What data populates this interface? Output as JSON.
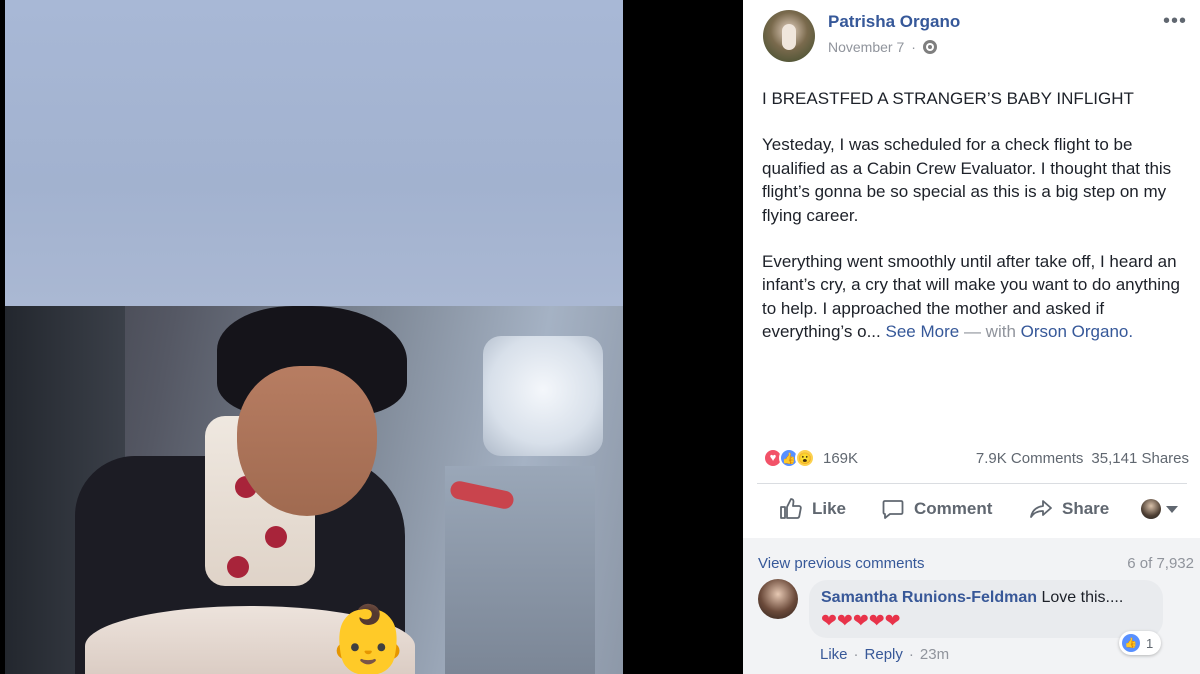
{
  "post": {
    "author": "Patrisha Organo",
    "date": "November 7",
    "date_separator": "·",
    "more": "•••",
    "headline": "I BREASTFED A STRANGER’S BABY INFLIGHT",
    "paragraph1": "Yesteday, I was scheduled for a check flight to be qualified as a Cabin Crew Evaluator. I thought that this flight’s gonna be so special as this is a big step on my flying career.",
    "paragraph2": "Everything went smoothly until after take off, I heard an infant’s cry, a cry that will make you want to do anything to help. I approached the mother and asked if everything’s o...",
    "see_more": "See More",
    "with_text": "— with",
    "tagged": "Orson Organo.",
    "tagged_display": "Orson Organo."
  },
  "stats": {
    "reactions_count": "169K",
    "comments": "7.9K Comments",
    "shares": "35,141 Shares"
  },
  "actions": {
    "like": "Like",
    "comment": "Comment",
    "share": "Share"
  },
  "comments": {
    "view_previous": "View previous comments",
    "count": "6 of 7,932",
    "items": [
      {
        "author": "Samantha Runions-Feldman",
        "text": "Love this....",
        "emoji": "❤❤❤❤❤",
        "reaction_count": "1",
        "like": "Like",
        "reply": "Reply",
        "time": "23m",
        "sep": "·"
      }
    ]
  },
  "colors": {
    "link": "#365899",
    "meta": "#90949c",
    "text": "#1d2129",
    "love": "#f25268",
    "like": "#5890ff",
    "wow": "#fcd250"
  },
  "icons": {
    "baby_sticker": "👶"
  }
}
